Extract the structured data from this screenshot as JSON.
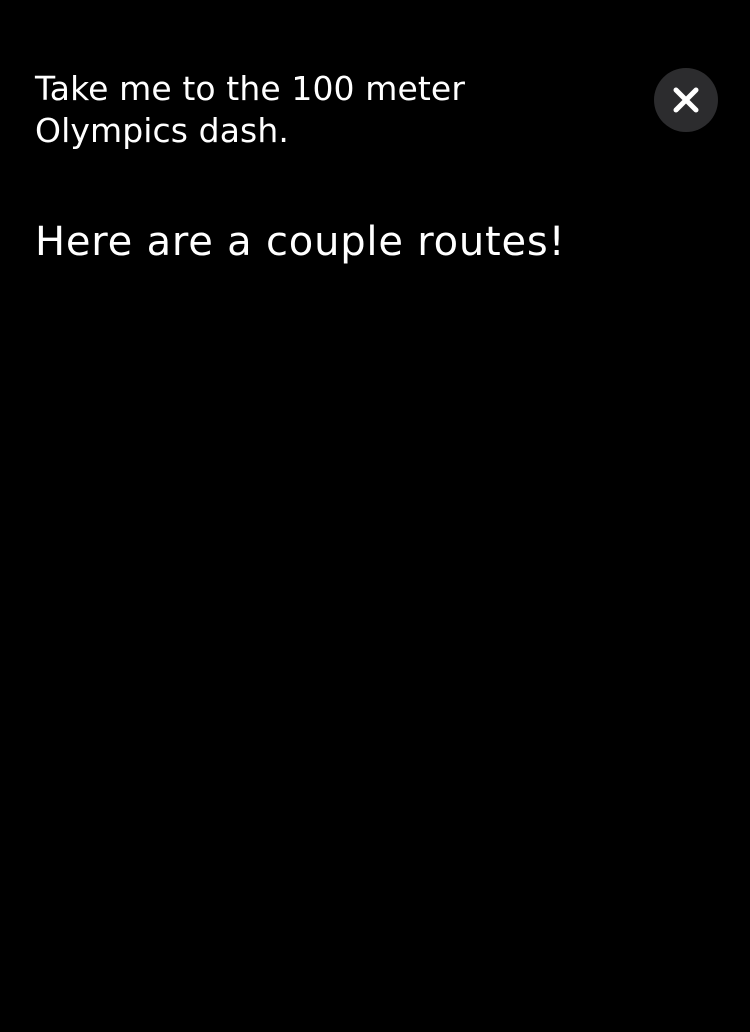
{
  "conversation": {
    "user_query": "Take me to the 100 meter Olympics dash.",
    "assistant_response": "Here are a couple routes!"
  },
  "close_button": {
    "icon": "close-icon",
    "background_color": "#2c2c2e",
    "icon_color": "#ffffff"
  },
  "theme": {
    "background": "#000000",
    "text": "#ffffff"
  }
}
